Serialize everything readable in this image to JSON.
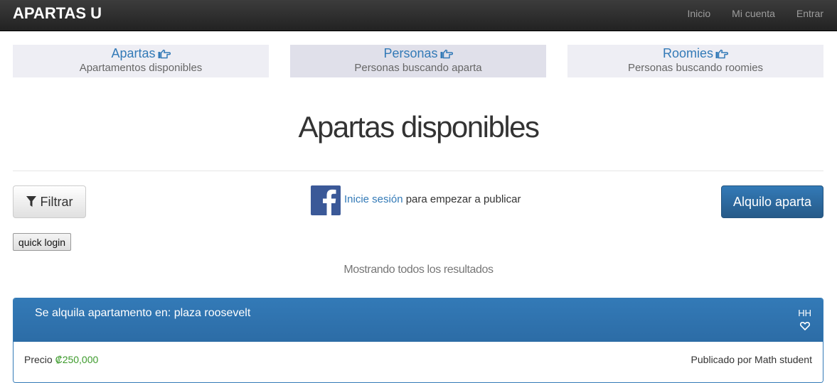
{
  "navbar": {
    "brand": "APARTAS U",
    "links": [
      "Inicio",
      "Mi cuenta",
      "Entrar"
    ]
  },
  "categories": [
    {
      "title": "Apartas",
      "subtitle": "Apartamentos disponibles",
      "active": false
    },
    {
      "title": "Personas",
      "subtitle": "Personas buscando aparta",
      "active": true
    },
    {
      "title": "Roomies",
      "subtitle": "Personas buscando roomies",
      "active": false
    }
  ],
  "main": {
    "title": "Apartas disponibles",
    "filter_label": "Filtrar",
    "login_link": "Inicie sesión",
    "login_suffix": " para empezar a publicar",
    "publish_label": "Alquilo aparta",
    "quick_login_label": "quick login",
    "showing_text": "Mostrando todos los resultados"
  },
  "listing": {
    "title": "Se alquila apartamento en: plaza roosevelt",
    "user_initials": "HH",
    "price_label": "Precio ",
    "price_value": "₡250,000",
    "author": "Publicado por Math student"
  },
  "icons": {
    "category_icon": "hand-pointing-right-icon",
    "filter_icon": "filter-icon",
    "facebook_icon": "facebook-icon",
    "favorite_icon": "heart-outline-icon"
  },
  "colors": {
    "navbar_bg": "#222222",
    "link_blue": "#337ab7",
    "primary": "#337ab7",
    "facebook": "#3b5998",
    "price_green": "#3c9a2b"
  }
}
